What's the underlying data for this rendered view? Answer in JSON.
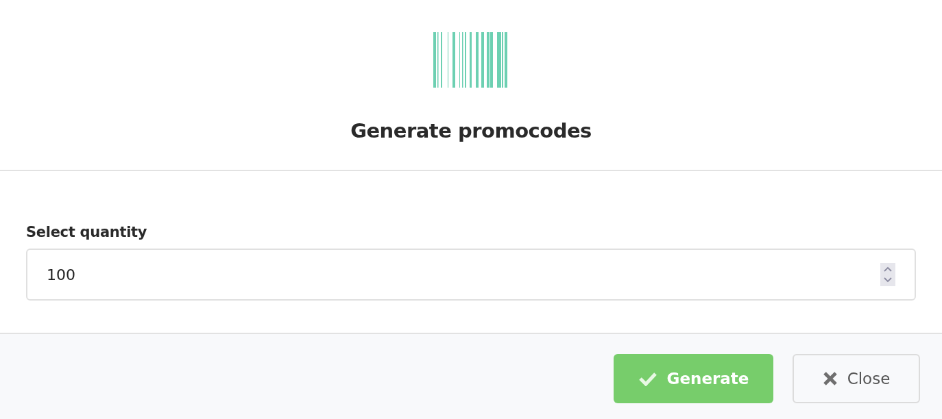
{
  "dialog": {
    "title": "Generate promocodes"
  },
  "field": {
    "label": "Select quantity",
    "value": "100"
  },
  "buttons": [
    {
      "label": "Generate",
      "kind": "primary"
    },
    {
      "label": "Close",
      "kind": "secondary"
    }
  ]
}
